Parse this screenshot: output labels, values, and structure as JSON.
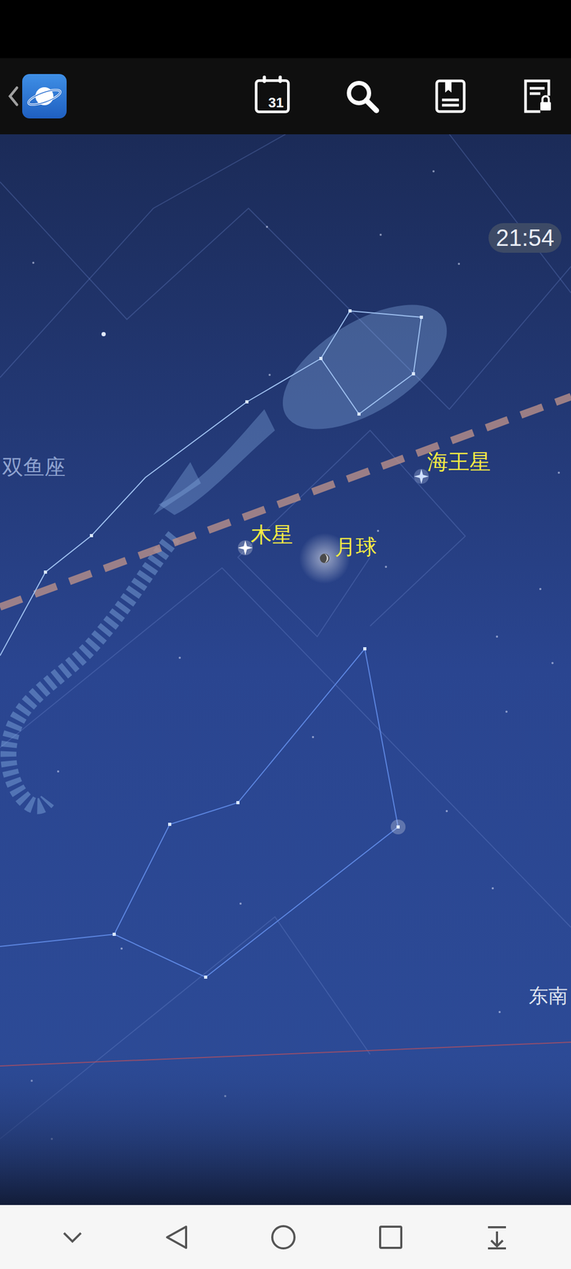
{
  "toolbar": {
    "calendar_day": "31"
  },
  "clock": "21:54",
  "constellations": [
    {
      "name": "双鱼座"
    }
  ],
  "objects": [
    {
      "name": "海王星",
      "kind": "neptune"
    },
    {
      "name": "木星",
      "kind": "jupiter"
    },
    {
      "name": "月球",
      "kind": "moon"
    }
  ],
  "directions": [
    {
      "name": "东南"
    }
  ]
}
